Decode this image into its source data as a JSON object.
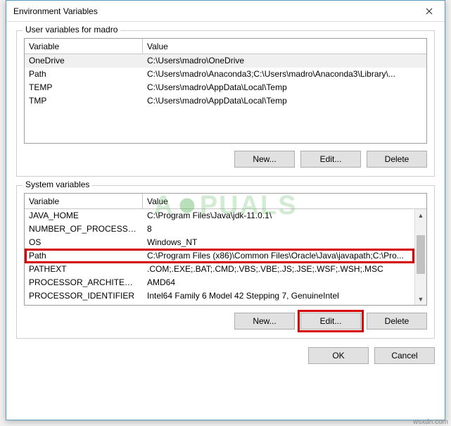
{
  "window": {
    "title": "Environment Variables"
  },
  "user_section": {
    "label": "User variables for madro",
    "columns": {
      "var": "Variable",
      "val": "Value"
    },
    "rows": [
      {
        "var": "OneDrive",
        "val": "C:\\Users\\madro\\OneDrive"
      },
      {
        "var": "Path",
        "val": "C:\\Users\\madro\\Anaconda3;C:\\Users\\madro\\Anaconda3\\Library\\..."
      },
      {
        "var": "TEMP",
        "val": "C:\\Users\\madro\\AppData\\Local\\Temp"
      },
      {
        "var": "TMP",
        "val": "C:\\Users\\madro\\AppData\\Local\\Temp"
      }
    ],
    "buttons": {
      "new": "New...",
      "edit": "Edit...",
      "delete": "Delete"
    }
  },
  "system_section": {
    "label": "System variables",
    "columns": {
      "var": "Variable",
      "val": "Value"
    },
    "rows": [
      {
        "var": "JAVA_HOME",
        "val": "C:\\Program Files\\Java\\jdk-11.0.1\\"
      },
      {
        "var": "NUMBER_OF_PROCESSORS",
        "val": "8"
      },
      {
        "var": "OS",
        "val": "Windows_NT"
      },
      {
        "var": "Path",
        "val": "C:\\Program Files (x86)\\Common Files\\Oracle\\Java\\javapath;C:\\Pro..."
      },
      {
        "var": "PATHEXT",
        "val": ".COM;.EXE;.BAT;.CMD;.VBS;.VBE;.JS;.JSE;.WSF;.WSH;.MSC"
      },
      {
        "var": "PROCESSOR_ARCHITECTURE",
        "val": "AMD64"
      },
      {
        "var": "PROCESSOR_IDENTIFIER",
        "val": "Intel64 Family 6 Model 42 Stepping 7, GenuineIntel"
      }
    ],
    "buttons": {
      "new": "New...",
      "edit": "Edit...",
      "delete": "Delete"
    }
  },
  "footer": {
    "ok": "OK",
    "cancel": "Cancel"
  },
  "watermark": {
    "left": "A",
    "right": "PUALS"
  },
  "source": "wsxdn.com"
}
